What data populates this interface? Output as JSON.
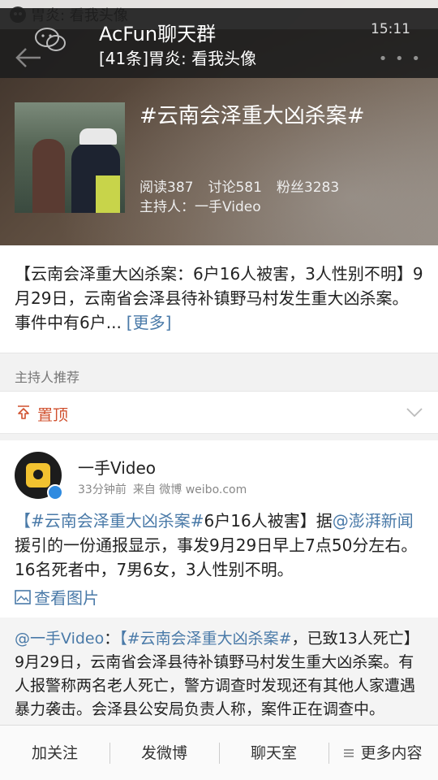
{
  "notification": {
    "text": "胃炎: 看我头像",
    "chat_title": "AcFun聊天群",
    "chat_subtitle": "[41条]胃炎: 看我头像",
    "time": "15:11"
  },
  "topic": {
    "title": "#云南会泽重大凶杀案#",
    "reads": "阅读387",
    "discussions": "讨论581",
    "fans": "粉丝3283",
    "host": "主持人：一手Video"
  },
  "summary": {
    "text": "【云南会泽重大凶杀案：6户16人被害，3人性别不明】9月29日，云南省会泽县待补镇野马村发生重大凶杀案。事件中有6户...",
    "more": "[更多]"
  },
  "section_label": "主持人推荐",
  "pinned": {
    "label": "置顶"
  },
  "post": {
    "author": "一手Video",
    "time": "33分钟前",
    "source": "来自 微博 weibo.com",
    "tag": "【#云南会泽重大凶杀案#",
    "text1": "6户16人被害】据",
    "mention": "@澎湃新闻",
    "text2": " 援引的一份通报显示，事发9月29日早上7点50分左右。16名死者中，7男6女，3人性别不明。",
    "view_images": "查看图片"
  },
  "repost": {
    "mention": "@一手Video",
    "colon": "：",
    "tag": "【#云南会泽重大凶杀案#",
    "text": "，已致13人死亡】9月29日，云南省会泽县待补镇野马村发生重大凶杀案。有人报警称两名老人死亡，警方调查时发现还有其他人家遭遇暴力袭击。会泽县公安局负责人称，案件正在调查中。"
  },
  "bottom_bar": {
    "follow": "加关注",
    "post": "发微博",
    "chat": "聊天室",
    "more": "更多内容"
  }
}
